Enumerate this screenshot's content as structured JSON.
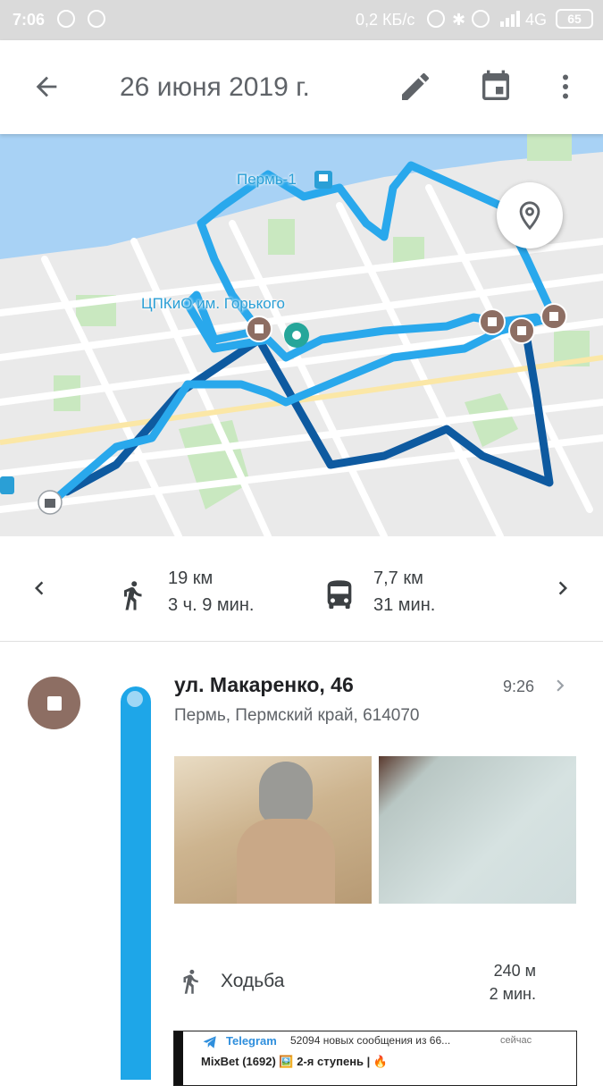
{
  "status_bar": {
    "time": "7:06",
    "network_speed": "0,2 КБ/с",
    "network_type": "4G",
    "battery": "65"
  },
  "app_bar": {
    "title": "26 июня 2019 г.",
    "icons": [
      "back-arrow-icon",
      "edit-pencil-icon",
      "calendar-icon",
      "more-vert-icon"
    ]
  },
  "map": {
    "labels": {
      "station": "Пермь-1",
      "park": "ЦПКиО им. Горького"
    },
    "colors": {
      "route_walk": "#29a8ec",
      "route_transit": "#0e5aa0",
      "stop_marker": "#8d6e63",
      "water": "#a8d2f5"
    }
  },
  "summary": {
    "walk": {
      "distance": "19 км",
      "duration": "3 ч. 9 мин."
    },
    "bus": {
      "distance": "7,7 км",
      "duration": "31 мин."
    }
  },
  "timeline": {
    "place": {
      "name": "ул. Макаренко, 46",
      "address": "Пермь, Пермский край, 614070",
      "time": "9:26"
    },
    "activity": {
      "label": "Ходьба",
      "distance": "240 м",
      "duration": "2 мин."
    },
    "notification_preview": {
      "app": "Telegram",
      "text": "52094 новых сообщения из 66...",
      "when": "сейчас",
      "line2": "MixBet (1692) 🖼️ 2-я ступень | 🔥"
    }
  },
  "accent_color": "#1ea6e8"
}
